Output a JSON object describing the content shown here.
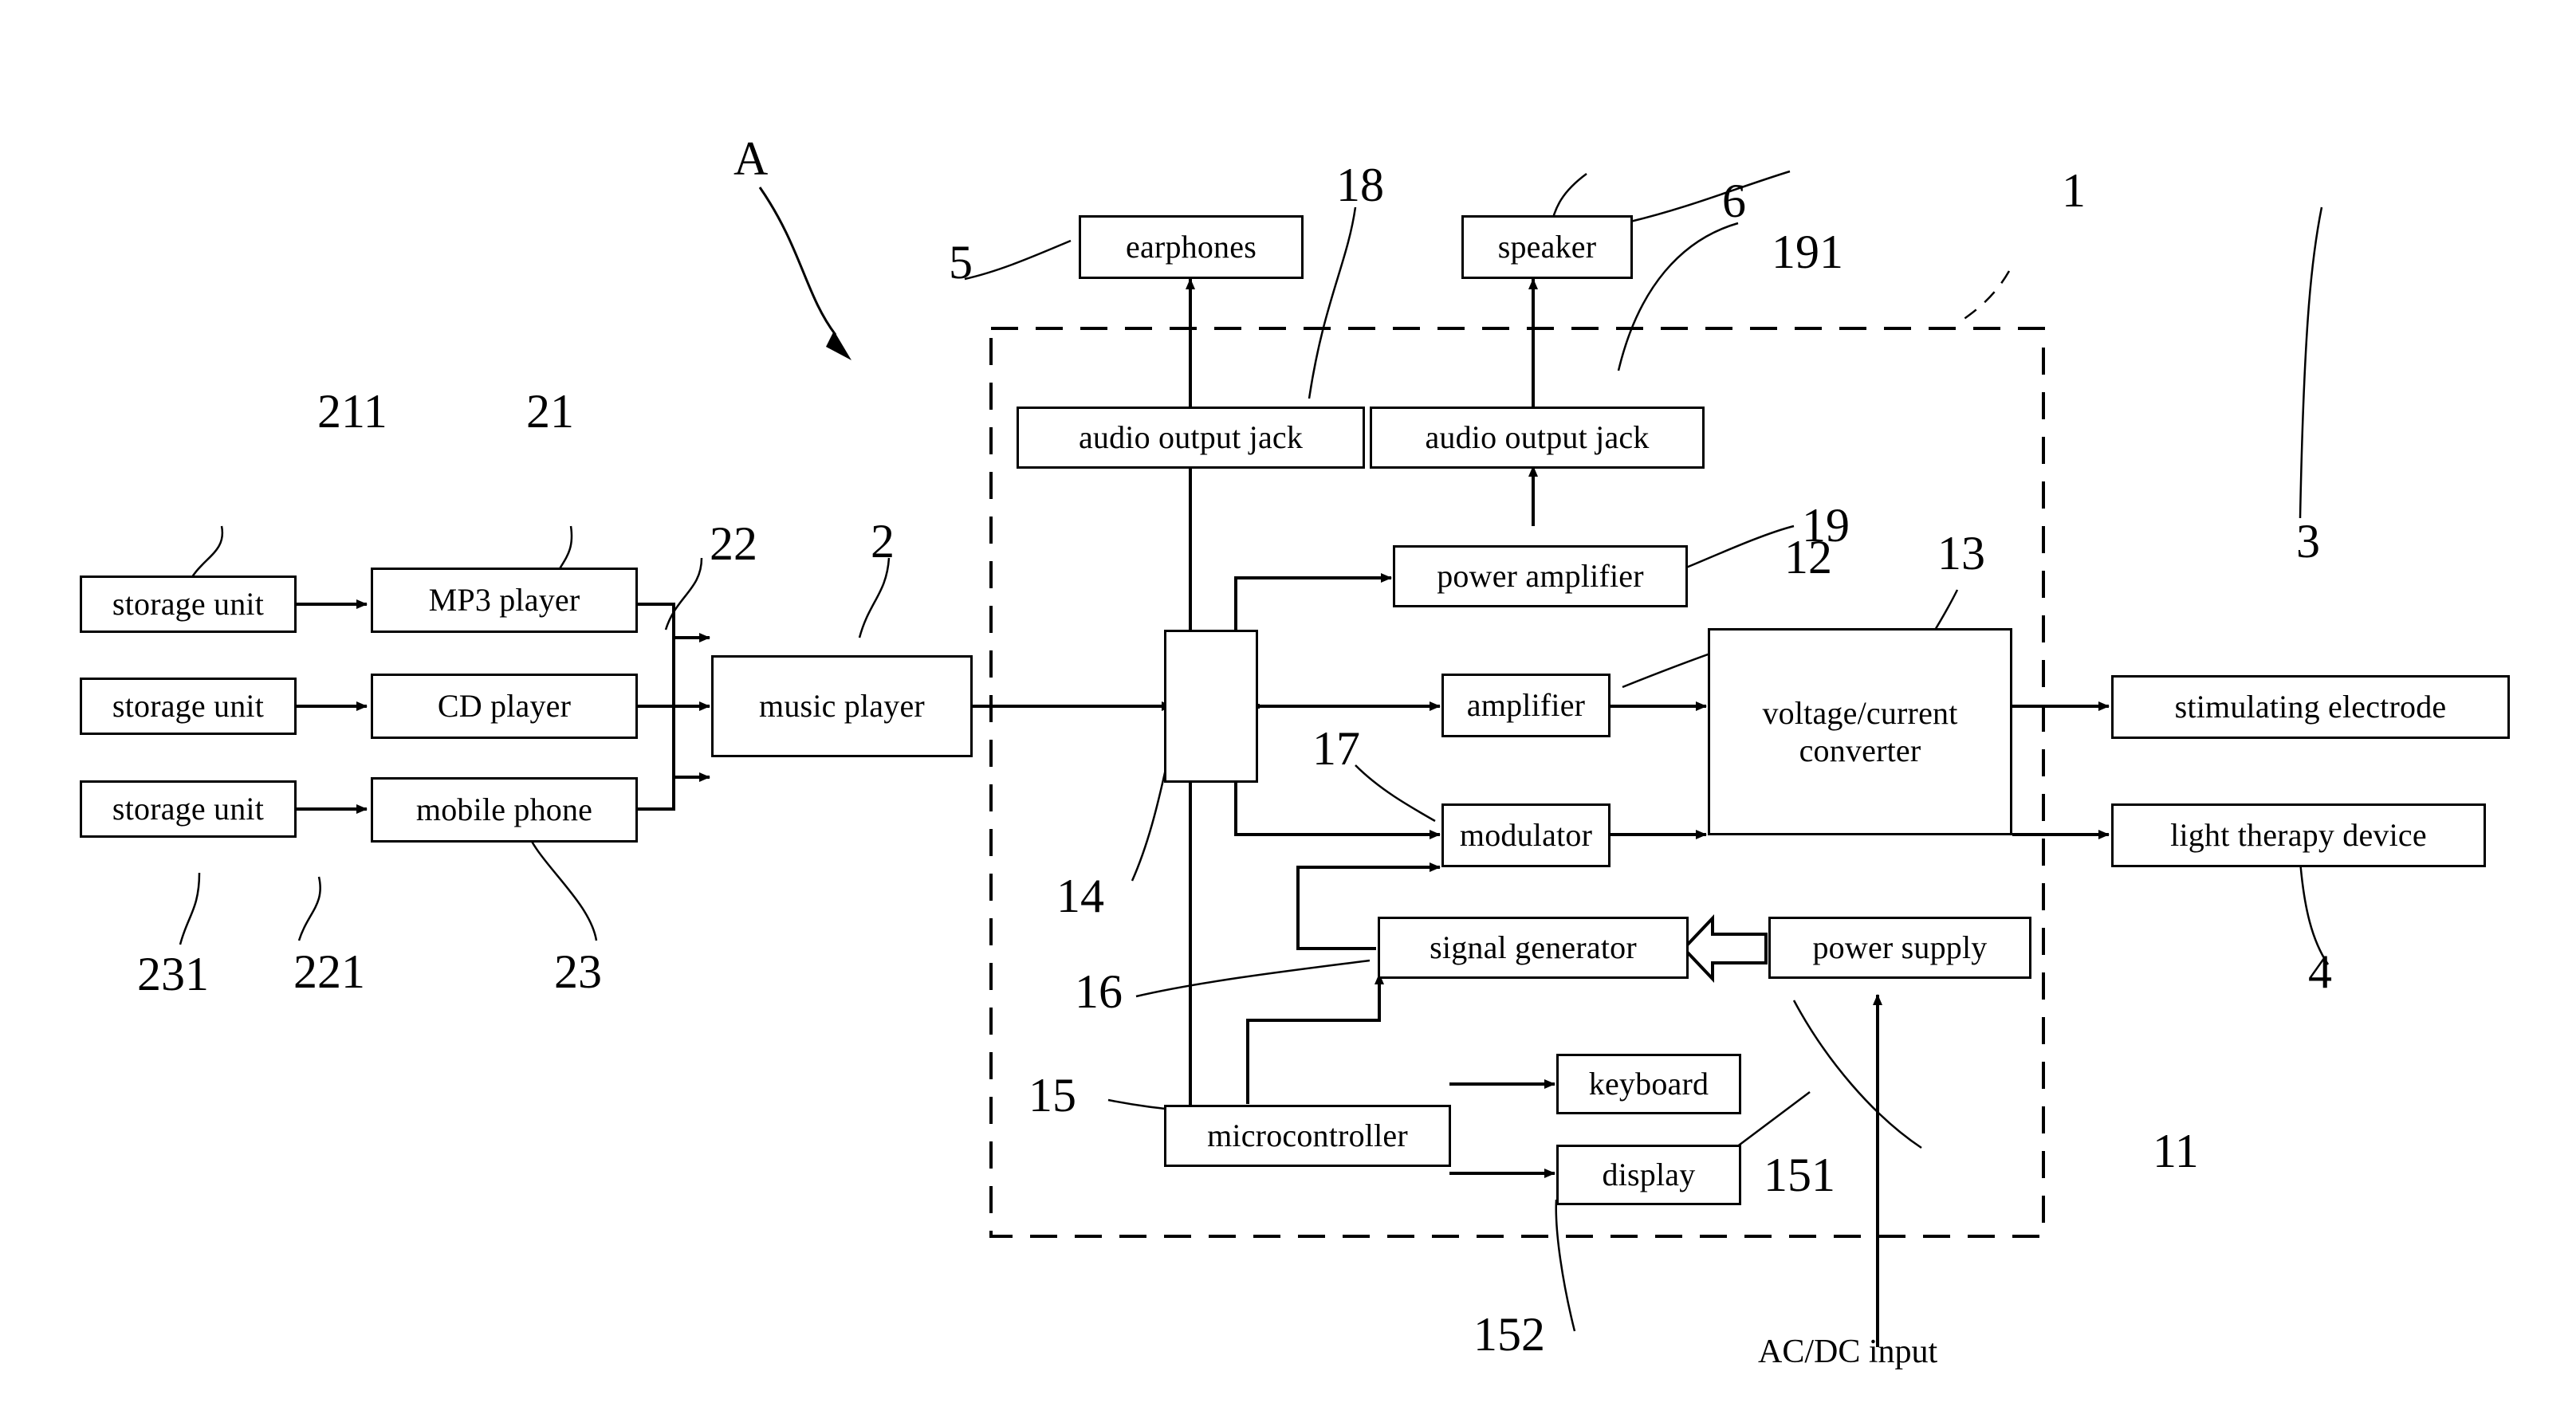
{
  "figure": {
    "type": "patent-block-diagram",
    "callout_A": "A",
    "external_label": "AC/DC input"
  },
  "nodes": {
    "storage_unit_1": "storage unit",
    "storage_unit_2": "storage unit",
    "storage_unit_3": "storage unit",
    "mp3_player": "MP3 player",
    "cd_player": "CD player",
    "mobile_phone": "mobile phone",
    "music_player": "music player",
    "earphones": "earphones",
    "speaker": "speaker",
    "audio_output_jack_left": "audio output jack",
    "audio_output_jack_right": "audio output jack",
    "power_amplifier": "power amplifier",
    "amplifier": "amplifier",
    "voltage_current_converter": "voltage/current converter",
    "modulator": "modulator",
    "signal_generator": "signal generator",
    "power_supply": "power supply",
    "microcontroller": "microcontroller",
    "keyboard": "keyboard",
    "display": "display",
    "stimulating_electrode": "stimulating electrode",
    "light_therapy_device": "light therapy device",
    "switch": ""
  },
  "reference_numerals": {
    "r1": "1",
    "r2": "2",
    "r3": "3",
    "r4": "4",
    "r5": "5",
    "r6": "6",
    "r11": "11",
    "r12": "12",
    "r13": "13",
    "r14": "14",
    "r15": "15",
    "r16": "16",
    "r17": "17",
    "r18": "18",
    "r19": "19",
    "r191": "191",
    "r21": "21",
    "r22": "22",
    "r23": "23",
    "r211": "211",
    "r221": "221",
    "r231": "231",
    "r151": "151",
    "r152": "152"
  },
  "colors": {
    "line": "#000000",
    "background": "#ffffff"
  }
}
